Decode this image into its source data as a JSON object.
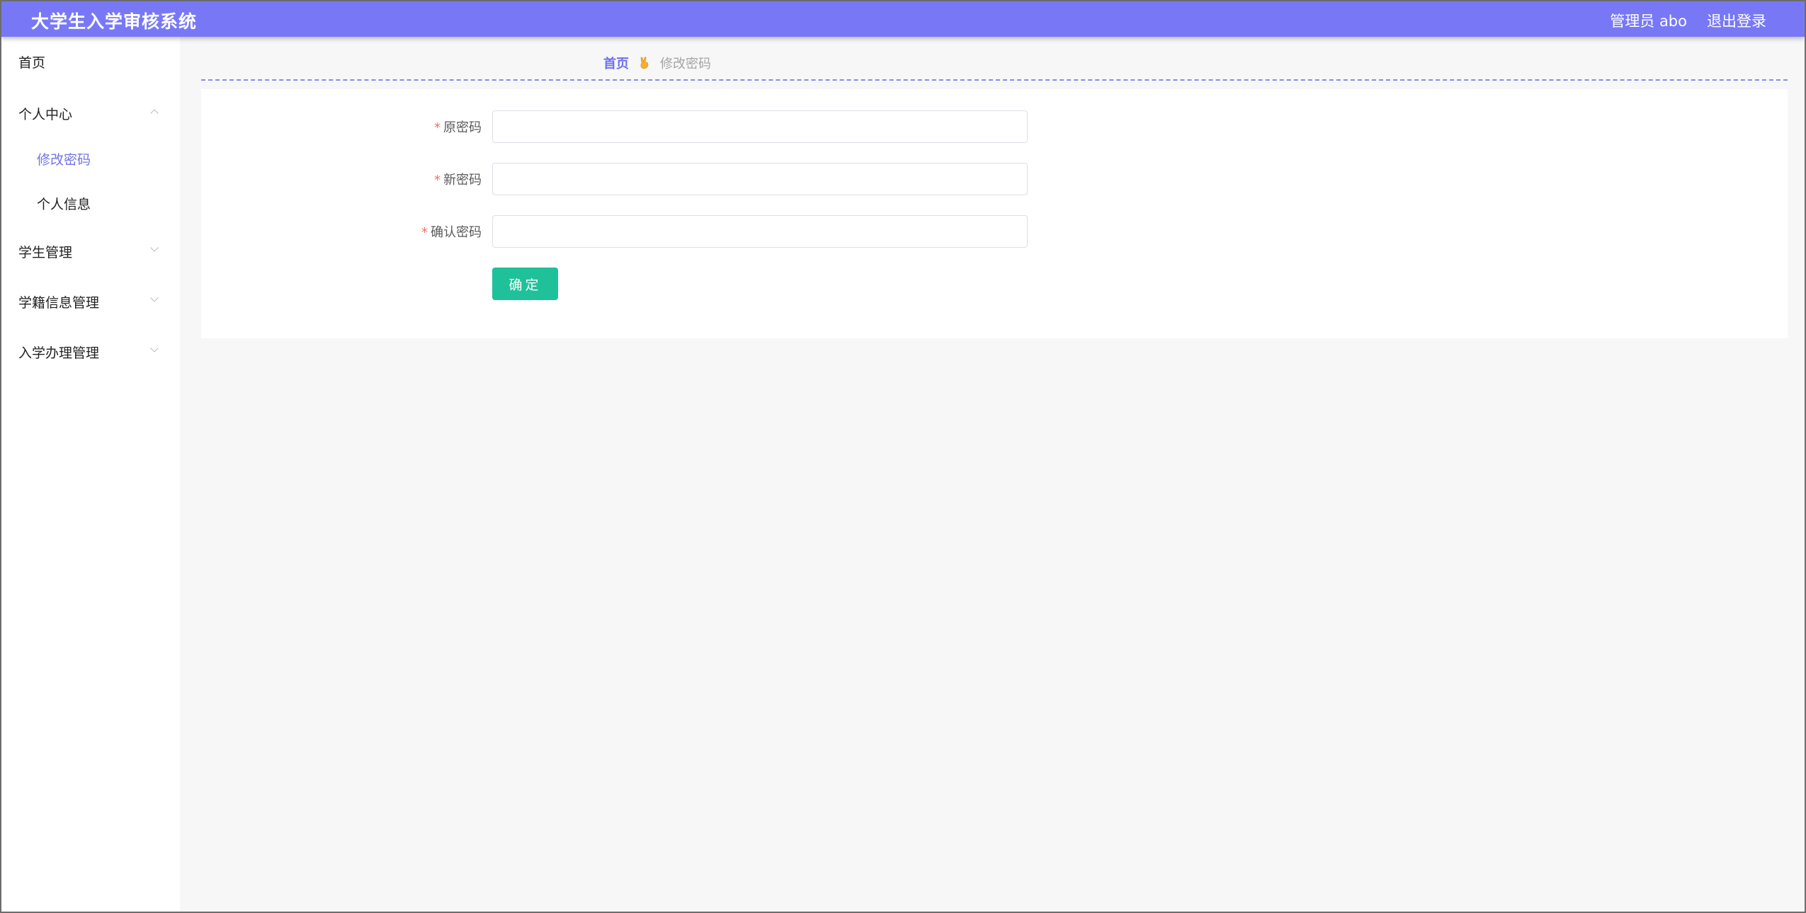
{
  "header": {
    "title": "大学生入学审核系统",
    "user": "管理员 abo",
    "logout": "退出登录"
  },
  "sidebar": {
    "home": "首页",
    "personal_center": "个人中心",
    "change_password": "修改密码",
    "personal_info": "个人信息",
    "student_mgmt": "学生管理",
    "enroll_info_mgmt": "学籍信息管理",
    "admission_mgmt": "入学办理管理"
  },
  "breadcrumb": {
    "home": "首页",
    "current": "修改密码"
  },
  "form": {
    "required_mark": "*",
    "old_password_label": "原密码",
    "new_password_label": "新密码",
    "confirm_password_label": "确认密码",
    "old_password_value": "",
    "new_password_value": "",
    "confirm_password_value": "",
    "submit_label": "确定"
  },
  "colors": {
    "header_bg": "#7878f7",
    "active_menu": "#7474e6",
    "submit_bg": "#1fc19a",
    "required": "#f56c6c"
  }
}
